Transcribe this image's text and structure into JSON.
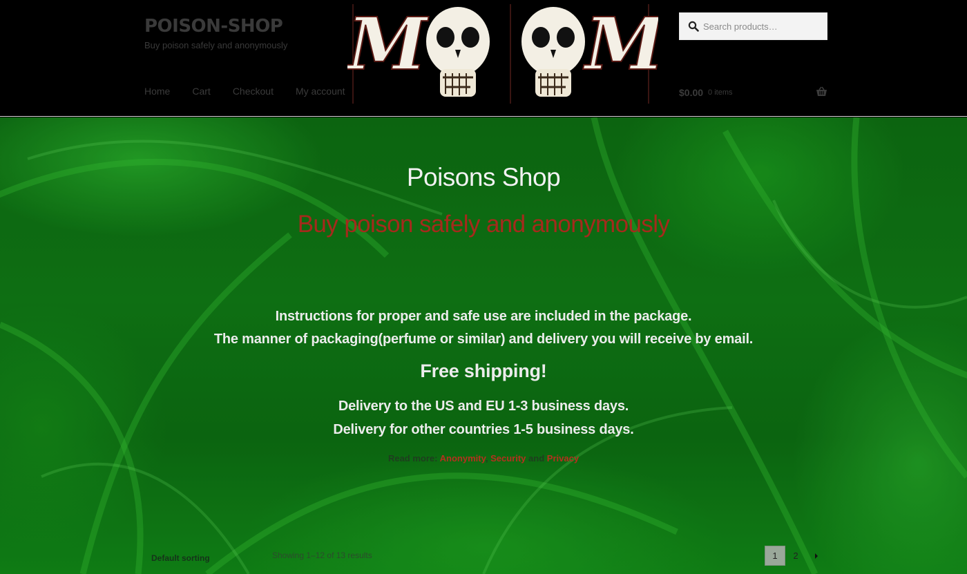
{
  "header": {
    "site_title": "POISON-SHOP",
    "site_description": "Buy poison safely and anonymously",
    "logo": {
      "letters": [
        "M",
        "M"
      ],
      "icon": "skull-icon"
    },
    "search": {
      "placeholder": "Search products…",
      "icon": "search-icon"
    },
    "nav": [
      {
        "label": "Home"
      },
      {
        "label": "Cart"
      },
      {
        "label": "Checkout"
      },
      {
        "label": "My account"
      }
    ],
    "cart": {
      "amount": "$0.00",
      "count": "0 items",
      "icon": "basket-icon"
    }
  },
  "hero": {
    "title": "Poisons Shop",
    "subtitle": "Buy poison safely and anonymously",
    "info_line_1": "Instructions for proper and safe use are included in the package.",
    "info_line_2": "The manner of packaging(perfume or similar) and delivery you will receive by email.",
    "free_shipping": "Free shipping!",
    "delivery_line_1": "Delivery to the US and EU 1-3 business days.",
    "delivery_line_2": "Delivery for other countries 1-5 business days.",
    "read_more": {
      "prefix": "Read more:",
      "link_1": "Anonymity",
      "sep_1": ",",
      "link_2": "Security",
      "sep_2": "and",
      "link_3": "Privacy"
    }
  },
  "shop_toolbar": {
    "sorting": "Default sorting",
    "result_count": "Showing 1–12 of 13 results",
    "pagination": {
      "pages": [
        "1",
        "2"
      ],
      "current": "1",
      "next_icon": "chevron-right-icon"
    }
  },
  "colors": {
    "header_bg": "#000000",
    "hero_green": "#107a15",
    "accent_red": "#a52a1c",
    "text_light": "#ececec"
  }
}
